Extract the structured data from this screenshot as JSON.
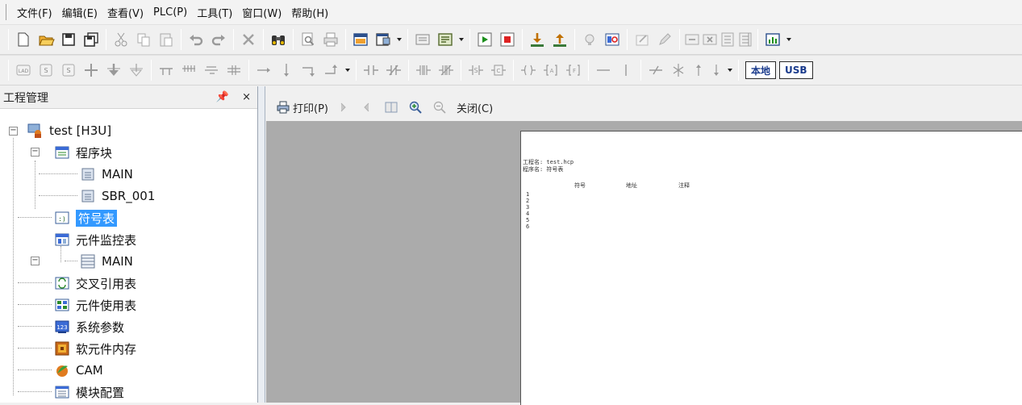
{
  "menu": [
    "文件(F)",
    "编辑(E)",
    "查看(V)",
    "PLC(P)",
    "工具(T)",
    "窗口(W)",
    "帮助(H)"
  ],
  "toolbar2": {
    "local_label": "本地",
    "usb_label": "USB"
  },
  "panel": {
    "title": "工程管理",
    "pin": "᛫",
    "close": "×"
  },
  "tree": {
    "root": "test [H3U]",
    "program_blocks": "程序块",
    "main": "MAIN",
    "sbr": "SBR_001",
    "symbol_table": "符号表",
    "monitor_table": "元件监控表",
    "monitor_main": "MAIN",
    "cross_ref": "交叉引用表",
    "usage_table": "元件使用表",
    "sys_params": "系统参数",
    "soft_memory": "软元件内存",
    "cam": "CAM",
    "module_config": "模块配置"
  },
  "preview": {
    "print_label": "打印(P)",
    "close_label": "关闭(C)"
  },
  "paper": {
    "project_line": "工程名: test.hcp",
    "program_line": "程序名: 符号表",
    "col_symbol": "符号",
    "col_address": "地址",
    "col_comment": "注释",
    "rows": [
      "1",
      "2",
      "3",
      "4",
      "5",
      "6"
    ]
  },
  "colors": {
    "accent": "#3399ff",
    "preview_bg": "#ababab"
  }
}
